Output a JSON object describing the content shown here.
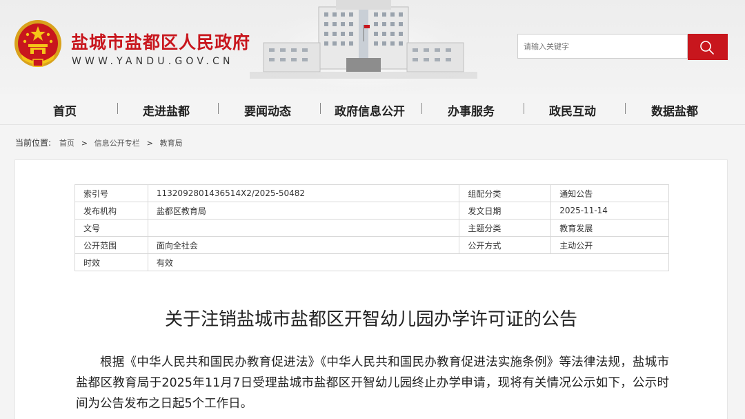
{
  "header": {
    "site_title": "盐城市盐都区人民政府",
    "site_url": "WWW.YANDU.GOV.CN",
    "search": {
      "placeholder": "请输入关键字"
    },
    "colors": {
      "brand_red": "#c8161d"
    },
    "icons": {
      "emblem": "national-emblem-icon",
      "search": "search-icon",
      "building": "government-building-image"
    }
  },
  "nav": {
    "items": [
      "首页",
      "走进盐都",
      "要闻动态",
      "政府信息公开",
      "办事服务",
      "政民互动",
      "数据盐都"
    ]
  },
  "breadcrumb": {
    "label": "当前位置:",
    "items": [
      "首页",
      "信息公开专栏",
      "教育局"
    ],
    "separator": ">"
  },
  "meta_table": {
    "rows": [
      [
        "索引号",
        "1132092801436514X2/2025-50482",
        "组配分类",
        "通知公告"
      ],
      [
        "发布机构",
        "盐都区教育局",
        "发文日期",
        "2025-11-14"
      ],
      [
        "文号",
        "",
        "主题分类",
        "教育发展"
      ],
      [
        "公开范围",
        "面向全社会",
        "公开方式",
        "主动公开"
      ],
      [
        "时效",
        "有效"
      ]
    ]
  },
  "article": {
    "title": "关于注销盐城市盐都区开智幼儿园办学许可证的公告",
    "paragraph": "根据《中华人民共和国民办教育促进法》《中华人民共和国民办教育促进法实施条例》等法律法规，盐城市盐都区教育局于2025年11月7日受理盐城市盐都区开智幼儿园终止办学申请，现将有关情况公示如下，公示时间为公告发布之日起5个工作日。"
  }
}
